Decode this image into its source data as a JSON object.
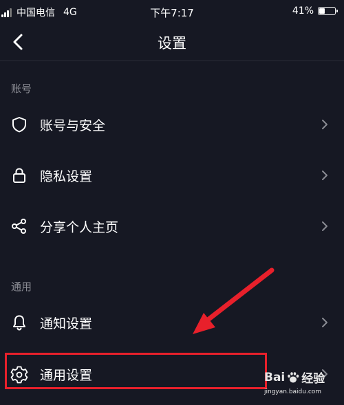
{
  "status_bar": {
    "carrier": "中国电信",
    "network": "4G",
    "time": "下午7:17",
    "battery_percent_label": "41%",
    "battery_level": 0.41
  },
  "nav": {
    "title": "设置"
  },
  "sections": [
    {
      "label": "账号",
      "items": [
        {
          "label": "账号与安全",
          "icon": "shield-icon"
        },
        {
          "label": "隐私设置",
          "icon": "lock-icon"
        },
        {
          "label": "分享个人主页",
          "icon": "share-icon"
        }
      ]
    },
    {
      "label": "通用",
      "items": [
        {
          "label": "通知设置",
          "icon": "bell-icon"
        },
        {
          "label": "通用设置",
          "icon": "gear-icon"
        }
      ]
    }
  ],
  "colors": {
    "background": "#161823",
    "annotation": "#e8202b",
    "section_text": "#8a8b93"
  },
  "watermark": {
    "brand_left": "Bai",
    "brand_right": "经验",
    "domain": "jingyan.baidu.com"
  }
}
